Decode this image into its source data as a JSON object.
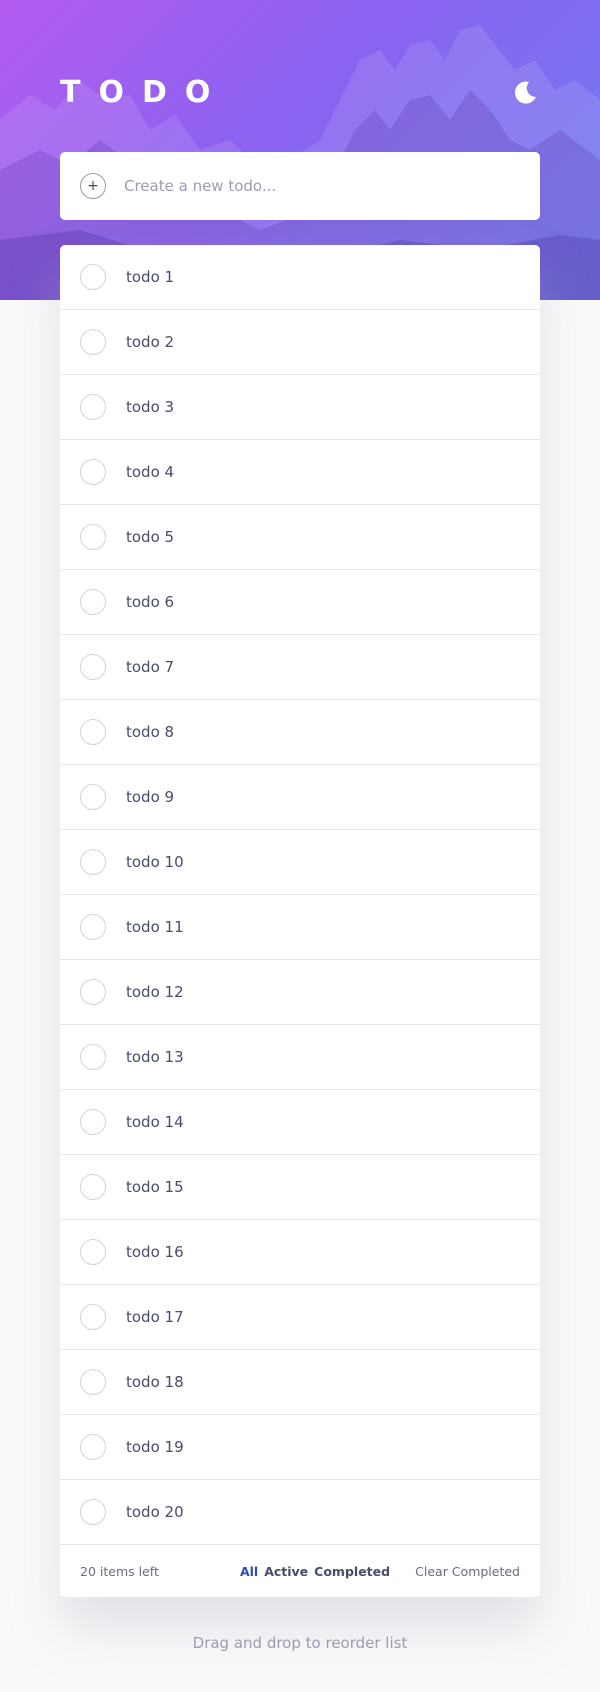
{
  "app": {
    "title": "TODO",
    "theme_icon": "moon-icon"
  },
  "new_todo": {
    "placeholder": "Create a new todo...",
    "add_icon": "plus-icon"
  },
  "todos": [
    {
      "label": "todo 1",
      "completed": false
    },
    {
      "label": "todo 2",
      "completed": false
    },
    {
      "label": "todo 3",
      "completed": false
    },
    {
      "label": "todo 4",
      "completed": false
    },
    {
      "label": "todo 5",
      "completed": false
    },
    {
      "label": "todo 6",
      "completed": false
    },
    {
      "label": "todo 7",
      "completed": false
    },
    {
      "label": "todo 8",
      "completed": false
    },
    {
      "label": "todo 9",
      "completed": false
    },
    {
      "label": "todo 10",
      "completed": false
    },
    {
      "label": "todo 11",
      "completed": false
    },
    {
      "label": "todo 12",
      "completed": false
    },
    {
      "label": "todo 13",
      "completed": false
    },
    {
      "label": "todo 14",
      "completed": false
    },
    {
      "label": "todo 15",
      "completed": false
    },
    {
      "label": "todo 16",
      "completed": false
    },
    {
      "label": "todo 17",
      "completed": false
    },
    {
      "label": "todo 18",
      "completed": false
    },
    {
      "label": "todo 19",
      "completed": false
    },
    {
      "label": "todo 20",
      "completed": false
    }
  ],
  "footer": {
    "items_left": "20 items left",
    "filters": [
      {
        "label": "All",
        "active": true
      },
      {
        "label": "Active",
        "active": false
      },
      {
        "label": "Completed",
        "active": false
      }
    ],
    "clear_label": "Clear Completed"
  },
  "hint": "Drag and drop to reorder list",
  "colors": {
    "accent": "#2c4fb8",
    "hero_gradient_start": "#b45cf0",
    "hero_gradient_end": "#6f7ef0",
    "background": "#fafafa"
  }
}
